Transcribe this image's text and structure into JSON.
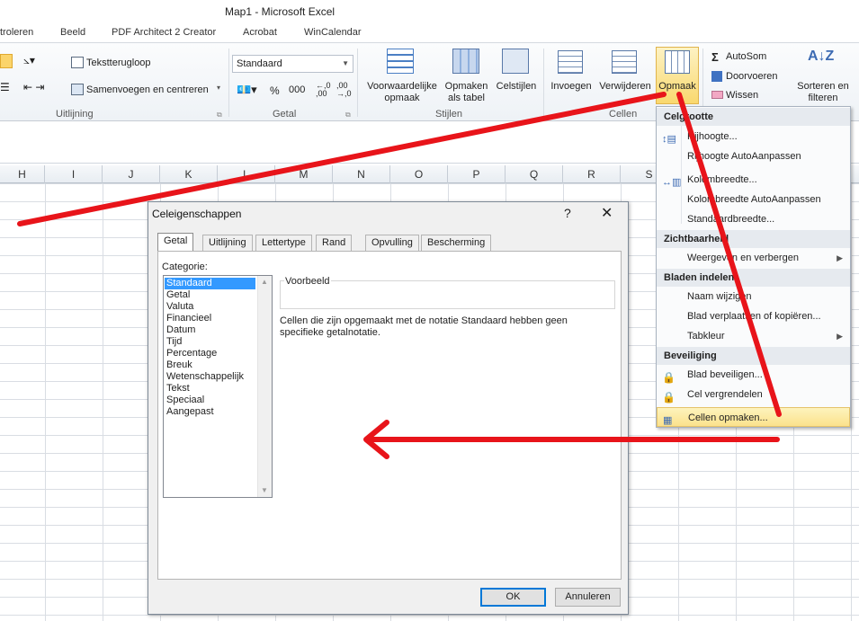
{
  "window": {
    "title": "Map1 - Microsoft Excel"
  },
  "ribbon_tabs": [
    "troleren",
    "Beeld",
    "PDF Architect 2 Creator",
    "Acrobat",
    "WinCalendar"
  ],
  "ribbon": {
    "alignment": {
      "wrap_text": "Tekstterugloop",
      "merge_center": "Samenvoegen en centreren",
      "label": "Uitlijning"
    },
    "number": {
      "format": "Standaard",
      "percent": "%",
      "thousands": "000",
      "label": "Getal"
    },
    "styles": {
      "conditional": "Voorwaardelijke opmaak",
      "as_table": "Opmaken als tabel",
      "cell_styles": "Celstijlen",
      "label": "Stijlen"
    },
    "cells": {
      "insert": "Invoegen",
      "delete": "Verwijderen",
      "format": "Opmaak",
      "label": "Cellen"
    },
    "editing": {
      "autosum": "AutoSom",
      "fill": "Doorvoeren",
      "clear": "Wissen",
      "sort_filter": "Sorteren en filteren"
    }
  },
  "columns": [
    "H",
    "I",
    "J",
    "K",
    "L",
    "M",
    "N",
    "O",
    "P",
    "Q",
    "R",
    "S"
  ],
  "format_menu": {
    "sections": [
      {
        "title": "Celgrootte",
        "items": [
          {
            "label": "Rijhoogte...",
            "icon": "row-height-icon"
          },
          {
            "label": "Rijhoogte AutoAanpassen"
          },
          {
            "label": "Kolombreedte...",
            "icon": "column-width-icon"
          },
          {
            "label": "Kolombreedte AutoAanpassen"
          },
          {
            "label": "Standaardbreedte..."
          }
        ]
      },
      {
        "title": "Zichtbaarheid",
        "items": [
          {
            "label": "Weergeven en verbergen",
            "submenu": true
          }
        ]
      },
      {
        "title": "Bladen indelen",
        "items": [
          {
            "label": "Naam wijzigen"
          },
          {
            "label": "Blad verplaatsen of kopiëren..."
          },
          {
            "label": "Tabkleur",
            "submenu": true
          }
        ]
      },
      {
        "title": "Beveiliging",
        "items": [
          {
            "label": "Blad beveiligen...",
            "icon": "protect-sheet-icon"
          },
          {
            "label": "Cel vergrendelen",
            "icon": "lock-icon"
          },
          {
            "label": "Cellen opmaken...",
            "icon": "format-cells-icon",
            "highlighted": true
          }
        ]
      }
    ]
  },
  "dialog": {
    "title": "Celeigenschappen",
    "help": "?",
    "close": "✕",
    "tabs": [
      "Getal",
      "Uitlijning",
      "Lettertype",
      "Rand",
      "Opvulling",
      "Bescherming"
    ],
    "active_tab": "Getal",
    "category_label": "Categorie:",
    "categories": [
      "Standaard",
      "Getal",
      "Valuta",
      "Financieel",
      "Datum",
      "Tijd",
      "Percentage",
      "Breuk",
      "Wetenschappelijk",
      "Tekst",
      "Speciaal",
      "Aangepast"
    ],
    "selected_category": "Standaard",
    "preview_label": "Voorbeeld",
    "description": "Cellen die zijn opgemaakt met de notatie Standaard hebben geen specifieke getalnotatie.",
    "ok": "OK",
    "cancel": "Annuleren"
  },
  "colors": {
    "arrow": "#e8141a",
    "menu_highlight": "#fbe28c",
    "selection": "#3399ff",
    "ok_border": "#0078d7"
  }
}
